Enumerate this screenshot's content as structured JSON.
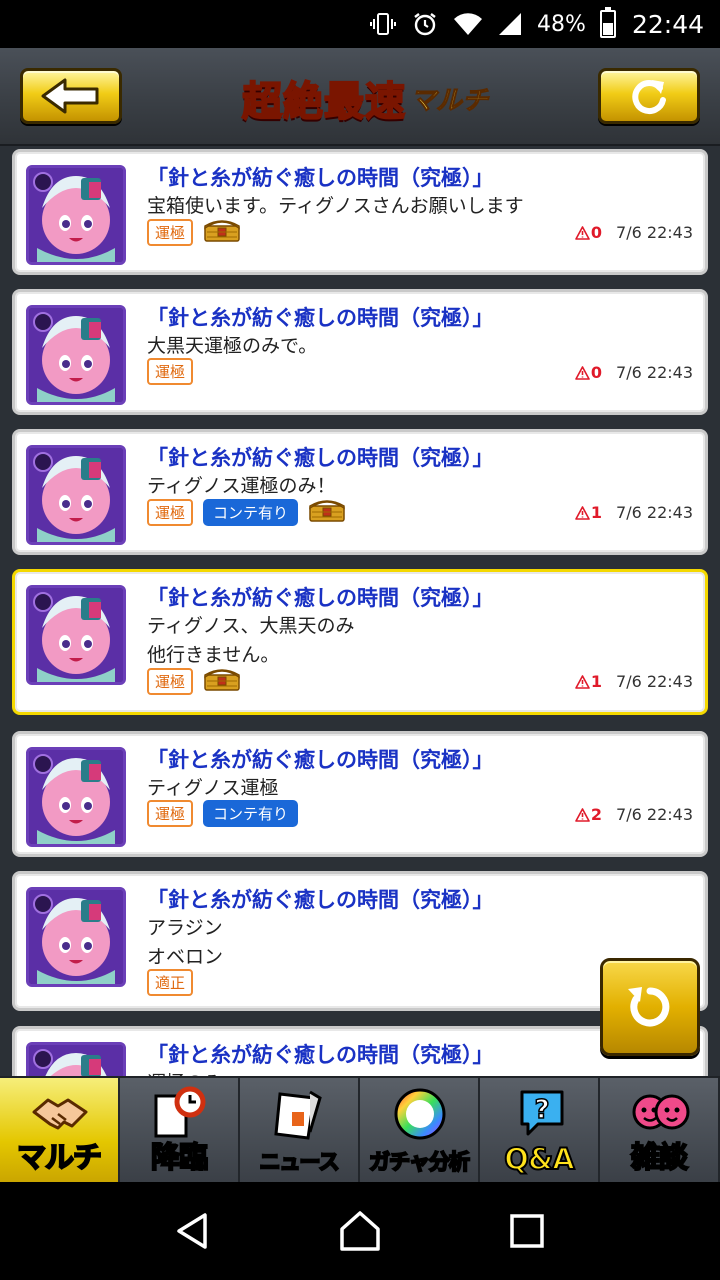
{
  "status_bar": {
    "battery": "48%",
    "time": "22:44",
    "battery_level": 0.48
  },
  "header": {
    "title_main": "超絶最速",
    "title_sub": "マルチ"
  },
  "posts": [
    {
      "title": "「針と糸が紡ぐ癒しの時間（究極）」",
      "message": [
        "宝箱使います。ティグノスさんお願いします"
      ],
      "tag_unkiwa": "運極",
      "tag_conte": "",
      "has_chest": true,
      "reports": "0",
      "timestamp": "7/6 22:43",
      "highlight": false
    },
    {
      "title": "「針と糸が紡ぐ癒しの時間（究極）」",
      "message": [
        "大黒天運極のみで。"
      ],
      "tag_unkiwa": "運極",
      "tag_conte": "",
      "has_chest": false,
      "reports": "0",
      "timestamp": "7/6 22:43",
      "highlight": false
    },
    {
      "title": "「針と糸が紡ぐ癒しの時間（究極）」",
      "message": [
        "ティグノス運極のみ！"
      ],
      "tag_unkiwa": "運極",
      "tag_conte": "コンテ有り",
      "has_chest": true,
      "reports": "1",
      "timestamp": "7/6 22:43",
      "highlight": false
    },
    {
      "title": "「針と糸が紡ぐ癒しの時間（究極）」",
      "message": [
        "ティグノス、大黒天のみ",
        "他行きません。"
      ],
      "tag_unkiwa": "運極",
      "tag_conte": "",
      "has_chest": true,
      "reports": "1",
      "timestamp": "7/6 22:43",
      "highlight": true
    },
    {
      "title": "「針と糸が紡ぐ癒しの時間（究極）」",
      "message": [
        "ティグノス運極"
      ],
      "tag_unkiwa": "運極",
      "tag_conte": "コンテ有り",
      "has_chest": false,
      "reports": "2",
      "timestamp": "7/6 22:43",
      "highlight": false
    },
    {
      "title": "「針と糸が紡ぐ癒しの時間（究極）」",
      "message": [
        "アラジン",
        "オベロン"
      ],
      "tag_unkiwa": "適正",
      "tag_conte": "",
      "has_chest": false,
      "reports": "",
      "timestamp": "",
      "highlight": false
    },
    {
      "title": "「針と糸が紡ぐ癒しの時間（究極）」",
      "message": [
        "運極のみ"
      ],
      "tag_unkiwa": "",
      "tag_conte": "",
      "has_chest": false,
      "reports": "",
      "timestamp": "",
      "highlight": false
    }
  ],
  "tabs": [
    {
      "label": "マルチ",
      "icon": "handshake-icon",
      "active": true
    },
    {
      "label": "降臨",
      "icon": "clock-document-icon",
      "active": false
    },
    {
      "label": "ニュース",
      "icon": "newspaper-icon",
      "active": false
    },
    {
      "label": "ガチャ分析",
      "icon": "rainbow-orb-icon",
      "active": false
    },
    {
      "label": "Q&A",
      "icon": "question-bubble-icon",
      "active": false
    },
    {
      "label": "雑談",
      "icon": "chat-faces-icon",
      "active": false
    }
  ],
  "colors": {
    "accent_gold": "#f1cc16",
    "title_blue": "#1a32c4",
    "warn_red": "#e01a2a",
    "conte_blue": "#1a68d8",
    "unkiwa_orange": "#e06a10"
  }
}
